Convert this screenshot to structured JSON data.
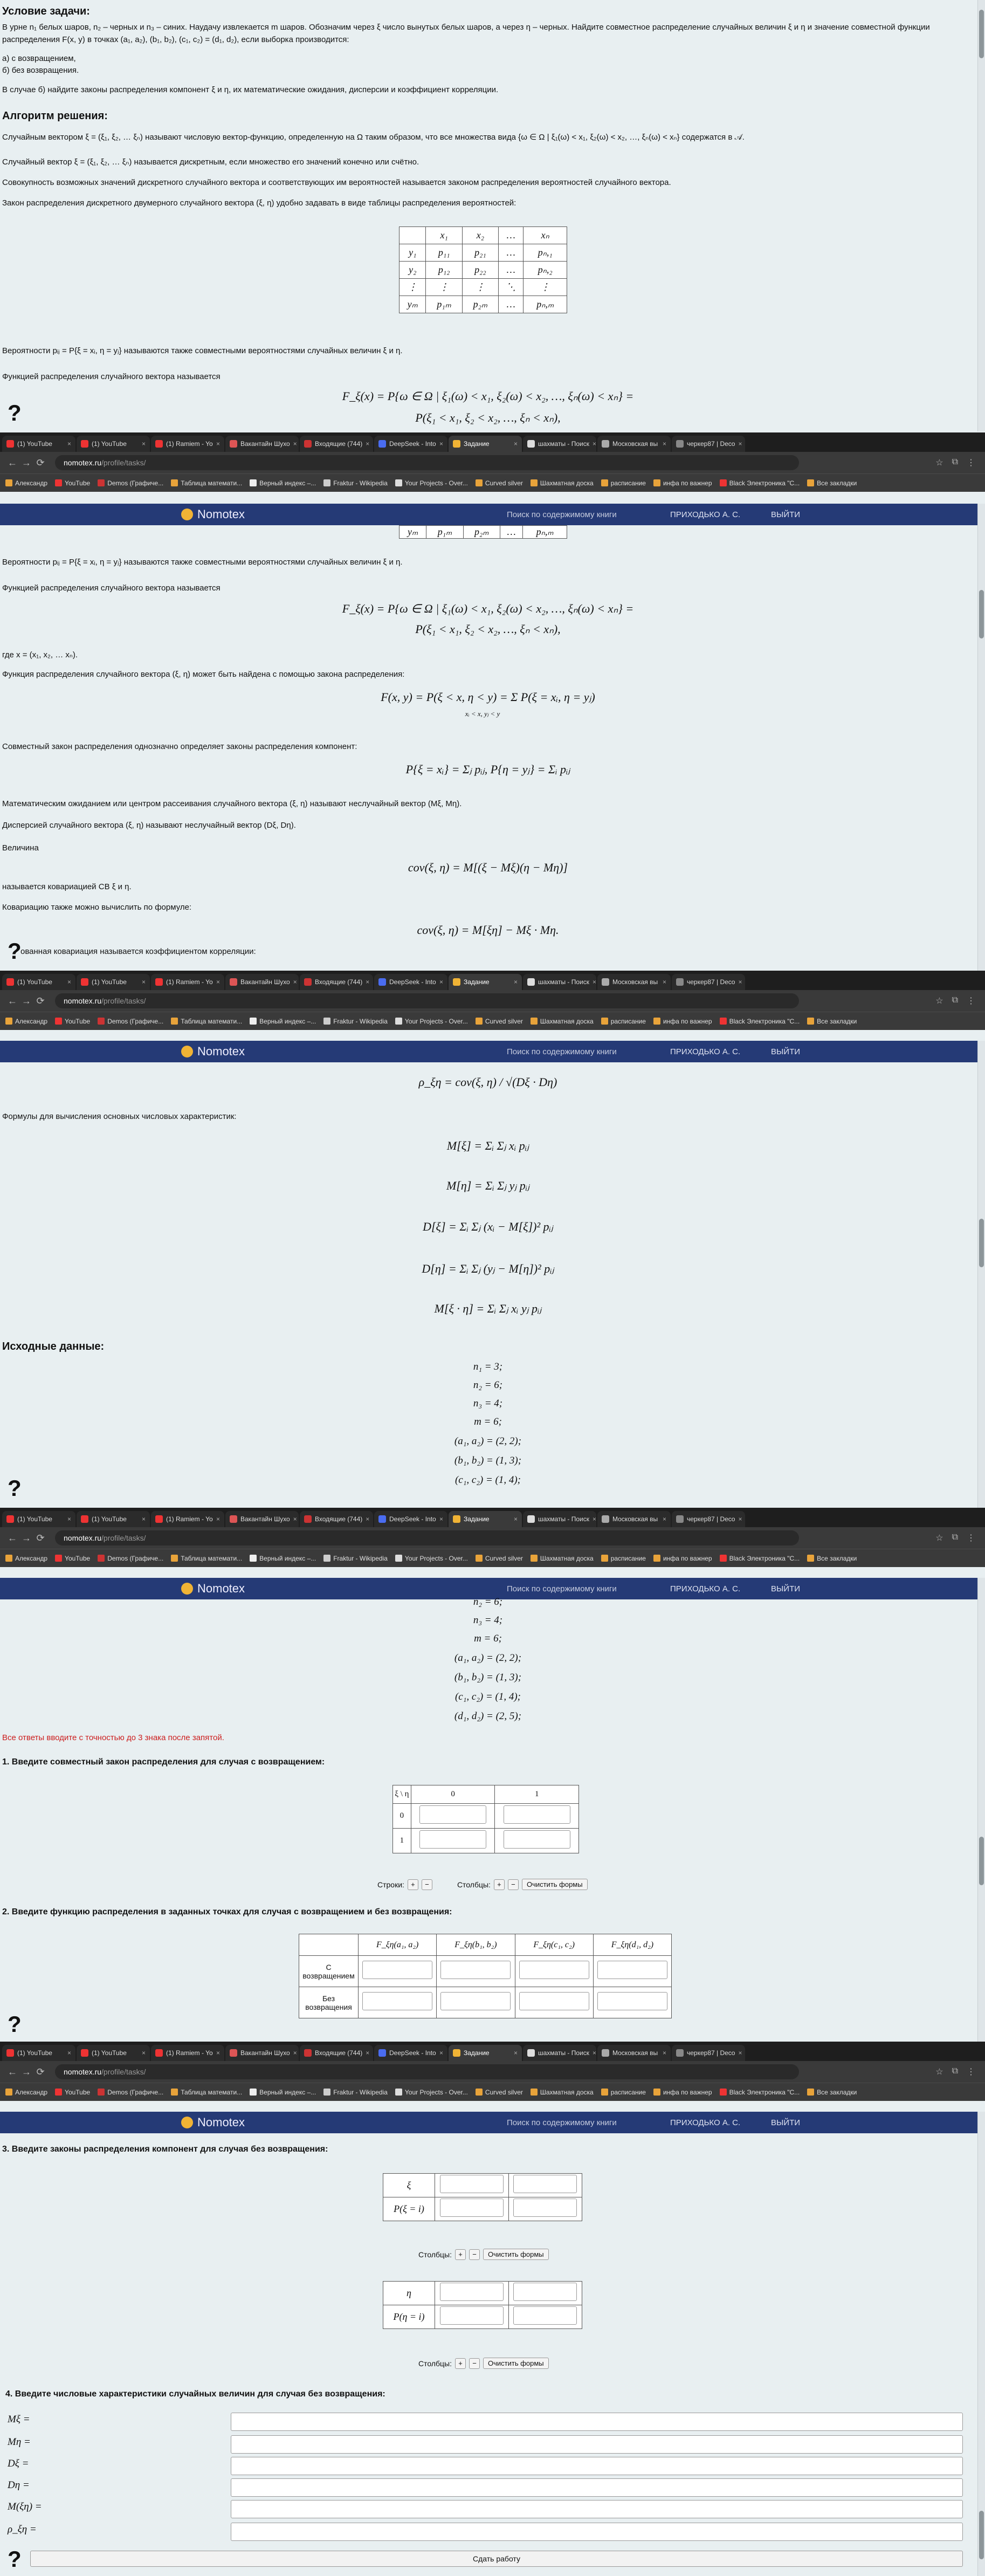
{
  "browser": {
    "tabs": [
      "(1) YouTube",
      "(1) YouTube",
      "(1) Ramiem - Yo",
      "Вакантайн Шухо",
      "Входящие (744)",
      "DeepSeek - Into",
      "Задание",
      "шахматы - Поиск",
      "Московская вы",
      "черкер87 | Deco"
    ],
    "active_tab": "Задание",
    "url_domain": "nomotex.ru",
    "url_path": "/profile/tasks/",
    "bookmarks": [
      "Александр",
      "YouTube",
      "Demos (Графиче...",
      "Таблица математи...",
      "Верный индекс –...",
      "Fraktur - Wikipedia",
      "Your Projects - Over...",
      "Curved silver",
      "Шахматная доска",
      "расписание",
      "инфа по важнер",
      "Black Электроника \"С...",
      "Все закладки"
    ]
  },
  "site": {
    "logo": "Nomotex",
    "search": "Поиск по содержимому книги",
    "user": "ПРИХОДЬКО А. С.",
    "logout": "ВЫЙТИ"
  },
  "condition": {
    "heading": "Условие задачи:",
    "text": "В урне n₁ белых шаров, n₂ – черных и n₃ – синих. Наудачу извлекается m шаров. Обозначим через ξ число вынутых белых шаров, а через η – черных. Найдите совместное распределение случайных величин ξ и η и значение совместной функции распределения F(x, y) в точках (a₁, a₂), (b₁, b₂), (c₁, c₂) = (d₁, d₂), если выборка производится:",
    "a": "а) с возвращением,",
    "b": "б) без возвращения.",
    "note": "В случае б) найдите законы распределения компонент ξ и η, их математические ожидания, дисперсии и коэффициент корреляции."
  },
  "algo": {
    "heading": "Алгоритм решения:",
    "p1": "Случайным вектором ξ = (ξ₁, ξ₂, … ξₙ) называют числовую вектор-функцию, определенную на Ω таким образом, что все множества вида {ω ∈ Ω | ξ₁(ω) < x₁, ξ₂(ω) < x₂, …, ξₙ(ω) < xₙ} содержатся в 𝒜.",
    "p2": "Случайный вектор ξ = (ξ₁, ξ₂, … ξₙ) называется дискретным, если множество его значений конечно или счётно.",
    "p3": "Совокупность возможных значений дискретного случайного вектора и соответствующих им вероятностей называется законом распределения вероятностей случайного вектора.",
    "p4": "Закон распределения дискретного двумерного случайного вектора (ξ, η) удобно задавать в виде таблицы распределения вероятностей:",
    "p5": "Вероятности pᵢⱼ = P{ξ = xᵢ, η = yⱼ} называются также совместными вероятностями случайных величин ξ и η.",
    "p6": "Функцией распределения случайного вектора называется",
    "f1": "F_ξ(x) = P{ω ∈ Ω | ξ₁(ω) < x₁, ξ₂(ω) < x₂, …, ξₙ(ω) < xₙ} =",
    "f2": "P(ξ₁ < x₁, ξ₂ < x₂, …, ξₙ < xₙ),",
    "p7": "где x = (x₁, x₂, … xₙ).",
    "p8": "Функция распределения случайного вектора (ξ, η) может быть найдена с помощью закона распределения:",
    "f3": "F(x, y) = P(ξ < x, η < y) = Σ P(ξ = xᵢ, η = yⱼ)",
    "f3s": "xᵢ < x, yⱼ < y",
    "p9": "Совместный закон распределения однозначно определяет законы распределения компонент:",
    "f4": "P{ξ = xᵢ} = Σⱼ pᵢⱼ,   P{η = yⱼ} = Σᵢ pᵢⱼ",
    "p10": "Математическим ожиданием или центром рассеивания случайного вектора (ξ, η) называют неслучайный вектор (Mξ, Mη).",
    "p11": "Дисперсией случайного вектора (ξ, η) называют неслучайный вектор (Dξ, Dη).",
    "p12": "Величина",
    "f5": "cov(ξ, η) = M[(ξ − Mξ)(η − Mη)]",
    "p13": "называется ковариацией СВ ξ и η.",
    "p14": "Ковариацию также можно вычислить по формуле:",
    "f6": "cov(ξ, η) = M[ξη] − Mξ · Mη.",
    "p15": "ованная ковариация называется коэффициентом корреляции:",
    "f7": "ρ_ξη = cov(ξ, η) / √(Dξ · Dη)",
    "p16": "Формулы для вычисления основных числовых характеристик:",
    "fm1": "M[ξ] = Σᵢ Σⱼ xᵢ pᵢⱼ",
    "fm2": "M[η] = Σᵢ Σⱼ yⱼ pᵢⱼ",
    "fm3": "D[ξ] = Σᵢ Σⱼ (xᵢ − M[ξ])² pᵢⱼ",
    "fm4": "D[η] = Σᵢ Σⱼ (yⱼ − M[η])² pᵢⱼ",
    "fm5": "M[ξ · η] = Σᵢ Σⱼ xᵢ yⱼ pᵢⱼ"
  },
  "dist_table": {
    "head": [
      "",
      "x₁",
      "x₂",
      "…",
      "xₙ"
    ],
    "rows": [
      [
        "y₁",
        "p₁₁",
        "p₂₁",
        "…",
        "pₙ,₁"
      ],
      [
        "y₂",
        "p₁₂",
        "p₂₂",
        "…",
        "pₙ,₂"
      ],
      [
        "⋮",
        "⋮",
        "⋮",
        "⋱",
        "⋮"
      ],
      [
        "yₘ",
        "p₁ₘ",
        "p₂ₘ",
        "…",
        "pₙ,ₘ"
      ]
    ]
  },
  "input": {
    "heading": "Исходные данные:",
    "values": [
      "n₁ = 3;",
      "n₂ = 6;",
      "n₃ = 4;",
      "m = 6;",
      "(a₁, a₂) = (2, 2);",
      "(b₁, b₂) = (1, 3);",
      "(c₁, c₂) = (1, 4);",
      "(d₁, d₂) = (2, 5);"
    ],
    "precision": "Все ответы вводите с точностью до 3 знака после запятой."
  },
  "q1": {
    "heading": "1. Введите совместный закон распределения для случая с возвращением:",
    "head": [
      "ξ \\ η",
      "0",
      "1"
    ],
    "rows": [
      "0",
      "1"
    ],
    "rows_label": "Строки:",
    "cols_label": "Столбцы:",
    "clear": "Очистить формы"
  },
  "q2": {
    "heading": "2. Введите функцию распределения в заданных точках для случая с возвращением и без возвращения:",
    "head": [
      "F_ξη(a₁, a₂)",
      "F_ξη(b₁, b₂)",
      "F_ξη(c₁, c₂)",
      "F_ξη(d₁, d₂)"
    ],
    "rows": [
      "С возвращением",
      "Без возвращения"
    ]
  },
  "q3": {
    "heading": "3. Введите законы распределения компонент для случая без возвращения:",
    "xi_rows": [
      "ξ",
      "P(ξ = i)"
    ],
    "eta_rows": [
      "η",
      "P(η = i)"
    ],
    "cols_label": "Столбцы:",
    "clear": "Очистить формы"
  },
  "q4": {
    "heading": "4. Введите числовые характеристики случайных величин для случая без возвращения:",
    "labels": [
      "Mξ =",
      "Mη =",
      "Dξ =",
      "Dη =",
      "M(ξη) =",
      "ρ_ξη ="
    ]
  },
  "submit": "Сдать работу",
  "help": "?"
}
